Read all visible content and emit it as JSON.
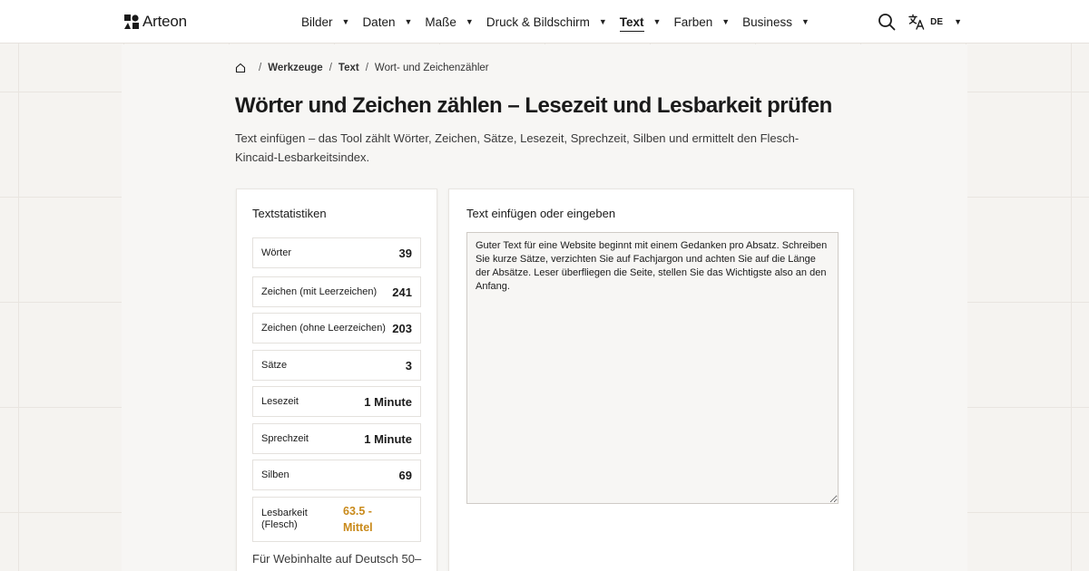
{
  "header": {
    "logo_text": "Arteon",
    "nav": [
      {
        "label": "Bilder"
      },
      {
        "label": "Daten"
      },
      {
        "label": "Maße"
      },
      {
        "label": "Druck & Bildschirm"
      },
      {
        "label": "Text"
      },
      {
        "label": "Farben"
      },
      {
        "label": "Business"
      }
    ],
    "active_nav": "Text",
    "language": "DE"
  },
  "breadcrumb": {
    "items": [
      "Werkzeuge",
      "Text"
    ],
    "current": "Wort- und Zeichenzähler"
  },
  "page": {
    "title": "Wörter und Zeichen zählen – Lesezeit und Lesbarkeit prüfen",
    "description": "Text einfügen – das Tool zählt Wörter, Zeichen, Sätze, Lesezeit, Sprechzeit, Silben und ermittelt den Flesch-Kincaid-Lesbarkeitsindex."
  },
  "stats": {
    "title": "Textstatistiken",
    "rows": [
      {
        "label": "Wörter",
        "value": "39"
      },
      {
        "label": "Zeichen (mit Leerzeichen)",
        "value": "241"
      },
      {
        "label": "Zeichen (ohne Leerzeichen)",
        "value": "203"
      },
      {
        "label": "Sätze",
        "value": "3"
      },
      {
        "label": "Lesezeit",
        "value": "1 Minute"
      },
      {
        "label": "Sprechzeit",
        "value": "1 Minute"
      },
      {
        "label": "Silben",
        "value": "69"
      },
      {
        "label": "Lesbarkeit (Flesch)",
        "value": "63.5 - Mittel"
      }
    ],
    "readability_color": "#c98a1b",
    "note": "Für Webinhalte auf Deutsch 50–"
  },
  "editor": {
    "title": "Text einfügen oder eingeben",
    "value": "Guter Text für eine Website beginnt mit einem Gedanken pro Absatz. Schreiben Sie kurze Sätze, verzichten Sie auf Fachjargon und achten Sie auf die Länge der Absätze. Leser überfliegen die Seite, stellen Sie das Wichtigste also an den Anfang."
  }
}
